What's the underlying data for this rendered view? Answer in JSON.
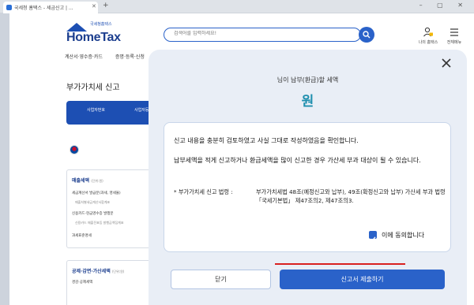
{
  "browser": {
    "tab_title": "국세청 홈택스 - 세금신고 | ...",
    "new_tab_symbol": "+",
    "window_controls": "– ▢ ✕"
  },
  "header": {
    "logo_sub": "국세청홈택스",
    "logo_main": "HomeTax",
    "search_placeholder": "검색어를 입력하세요!",
    "utilities": [
      {
        "label": "나의 홈택스",
        "icon": "user-lock-icon"
      },
      {
        "label": "전체메뉴",
        "icon": "hamburger-menu-icon"
      }
    ]
  },
  "nav": {
    "items": [
      "계산서·영수증·카드",
      "증명·등록·신청"
    ]
  },
  "background_page": {
    "title": "부가가치세 신고",
    "tabs": [
      "사업자번호",
      "사업자등록"
    ],
    "panel1": {
      "heading": "매출세액",
      "heading_note": "(단위:원)",
      "items": [
        "세금계산서 발급분(과세, 영세율)",
        "신용카드·현금영수증 발행분",
        "과세표준명세"
      ],
      "subitems": [
        "매출처별세금계산서합계표",
        "신용카드 매출전표등 발행금액집계표"
      ]
    },
    "panel2": {
      "heading": "공제·감면·가산세액",
      "heading_note": "(단위:원)",
      "items": [
        "경감·공제세액"
      ]
    }
  },
  "modal": {
    "subtitle": "님이 납부(환급)할 세액",
    "amount": "원",
    "notice": {
      "paragraph1": "신고 내용을 충분히 검토하였고 사실 그대로 작성하였음을 확인합니다.",
      "paragraph2": "납부세액을 적게 신고하거나 환급세액을 많이 신고한 경우 가산세 부과 대상이 될 수 있습니다.",
      "law_label": "* 부가가치세 신고 법령 :",
      "law_text": "부가가치세법 48조(예정신고와 납부), 49조(확정신고와 납부) 가산세 부과 법령 「국세기본법」 제47조의2, 제47조의3.",
      "agree_label": "이에 동의합니다",
      "agree_checked": true
    },
    "buttons": {
      "close": "닫기",
      "submit": "신고서 제출하기"
    }
  },
  "colors": {
    "brand_blue": "#2a62c9",
    "amount_teal": "#1f8fae",
    "modal_bg": "#e9eef6",
    "annotation_red": "#d92020"
  }
}
